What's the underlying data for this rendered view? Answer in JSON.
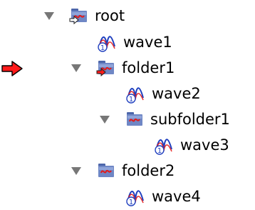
{
  "tree": {
    "nodes": [
      {
        "label": "root",
        "kind": "folder",
        "expanded": true,
        "current": true
      },
      {
        "label": "wave1",
        "kind": "wave"
      },
      {
        "label": "folder1",
        "kind": "folder",
        "expanded": true,
        "current": true
      },
      {
        "label": "wave2",
        "kind": "wave"
      },
      {
        "label": "subfolder1",
        "kind": "folder",
        "expanded": true
      },
      {
        "label": "wave3",
        "kind": "wave"
      },
      {
        "label": "folder2",
        "kind": "folder",
        "expanded": true
      },
      {
        "label": "wave4",
        "kind": "wave"
      }
    ]
  },
  "icons": {
    "folder": "folder-icon",
    "wave": "wave-icon",
    "current_folder_marker": "current-folder-arrow-icon",
    "disclosure": "disclosure-triangle-down-icon",
    "pointer": "red-arrow-pointer-icon"
  },
  "colors": {
    "folder_body": "#6f87c5",
    "folder_tab": "#4d66aa",
    "wave_line": "#e21a1a",
    "wave_circle": "#1f3fbf",
    "disclosure": "#777777",
    "pointer": "#ff0000"
  }
}
